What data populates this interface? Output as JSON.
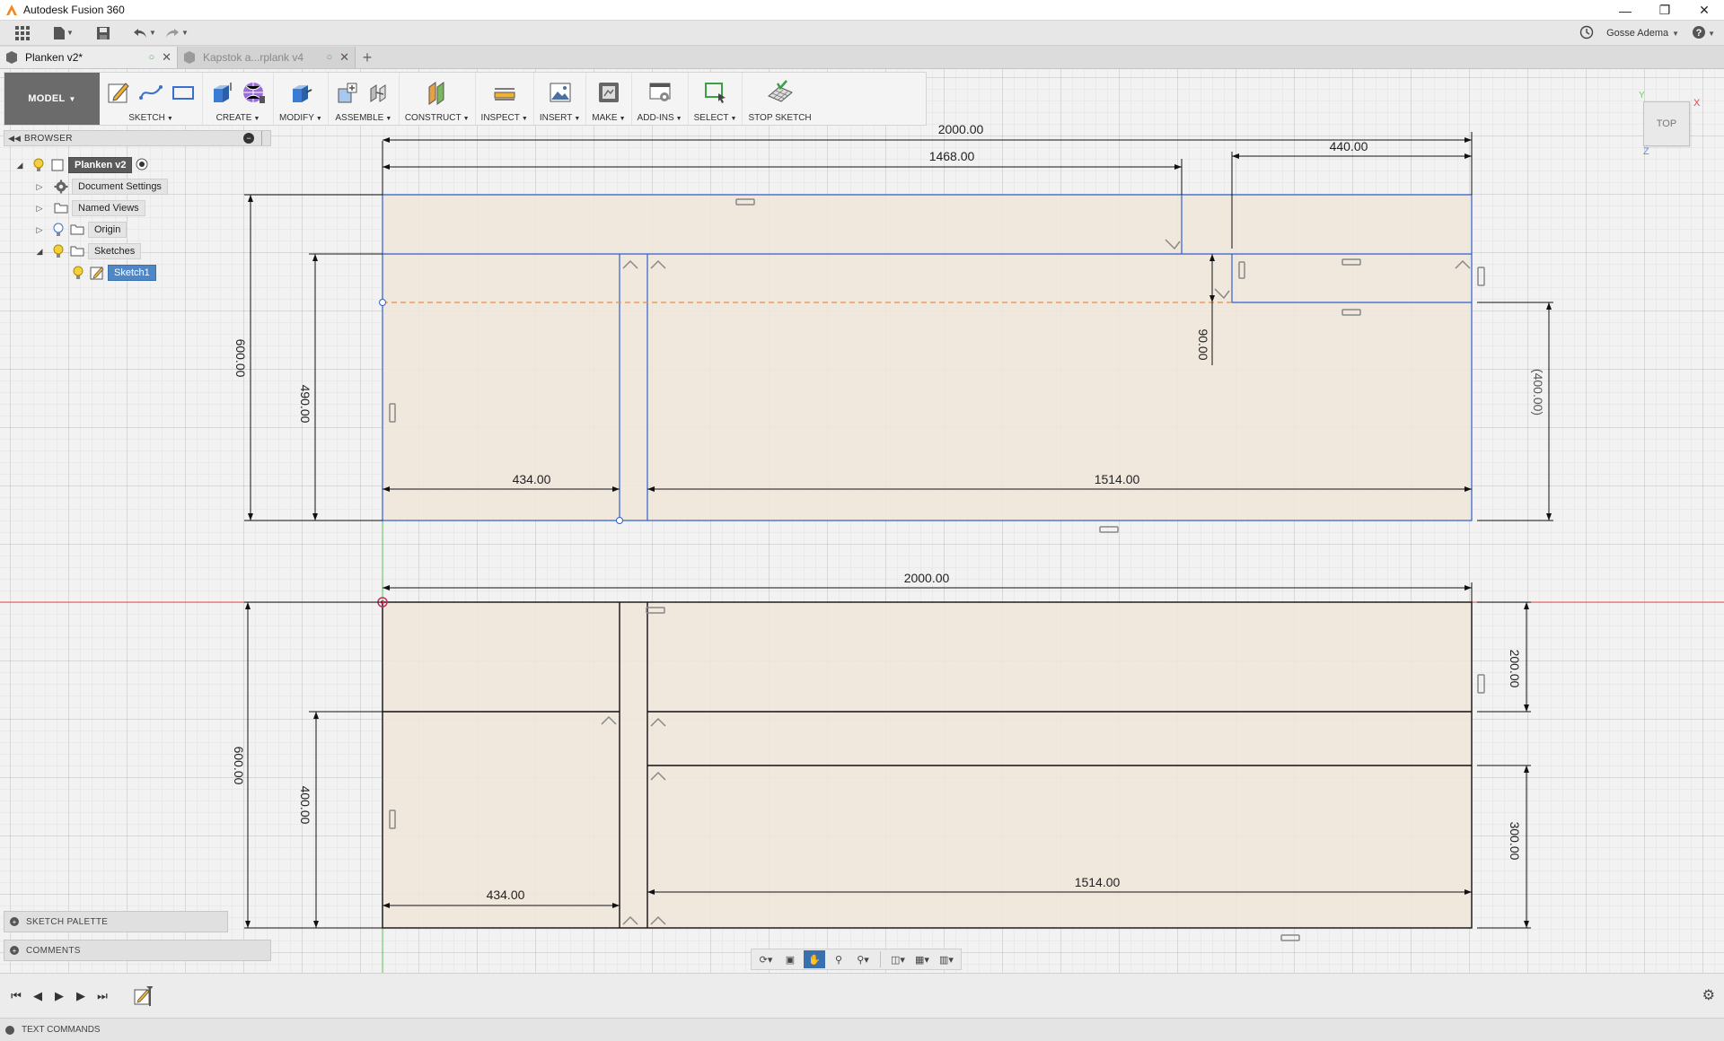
{
  "window": {
    "title": "Autodesk Fusion 360"
  },
  "quick_access": {
    "user_name": "Gosse Adema"
  },
  "tabs": [
    {
      "label": "Planken v2*",
      "active": true
    },
    {
      "label": "Kapstok a...rplank v4",
      "active": false
    }
  ],
  "toolbar": {
    "workspace": "MODEL",
    "groups": [
      {
        "label": "SKETCH"
      },
      {
        "label": "CREATE"
      },
      {
        "label": "MODIFY"
      },
      {
        "label": "ASSEMBLE"
      },
      {
        "label": "CONSTRUCT"
      },
      {
        "label": "INSPECT"
      },
      {
        "label": "INSERT"
      },
      {
        "label": "MAKE"
      },
      {
        "label": "ADD-INS"
      },
      {
        "label": "SELECT"
      },
      {
        "label": "STOP SKETCH"
      }
    ]
  },
  "browser": {
    "title": "BROWSER",
    "root": "Planken v2",
    "items": [
      {
        "label": "Document Settings"
      },
      {
        "label": "Named Views"
      },
      {
        "label": "Origin"
      },
      {
        "label": "Sketches"
      },
      {
        "label": "Sketch1"
      }
    ]
  },
  "panels": {
    "sketch_palette": "SKETCH PALETTE",
    "comments": "COMMENTS",
    "text_commands": "TEXT COMMANDS"
  },
  "viewcube": {
    "face": "TOP",
    "axis_x": "X",
    "axis_y": "Y",
    "axis_z": "Z"
  },
  "dimensions": {
    "top_overall": "2000.00",
    "top_1468": "1468.00",
    "top_440": "440.00",
    "top_height": "600.00",
    "top_490": "490.00",
    "top_90": "90.00",
    "top_400_ref": "(400.00)",
    "top_434": "434.00",
    "top_1514": "1514.00",
    "bot_overall": "2000.00",
    "bot_height": "600.00",
    "bot_400": "400.00",
    "bot_200": "200.00",
    "bot_300": "300.00",
    "bot_434": "434.00",
    "bot_1514": "1514.00"
  },
  "colors": {
    "sketch_fill": "#efe5da",
    "profile_blue": "#2f5fd0",
    "dimension_line": "#111111",
    "x_axis": "#e05050",
    "y_axis": "#5cc15c",
    "construction": "#e8904a"
  }
}
